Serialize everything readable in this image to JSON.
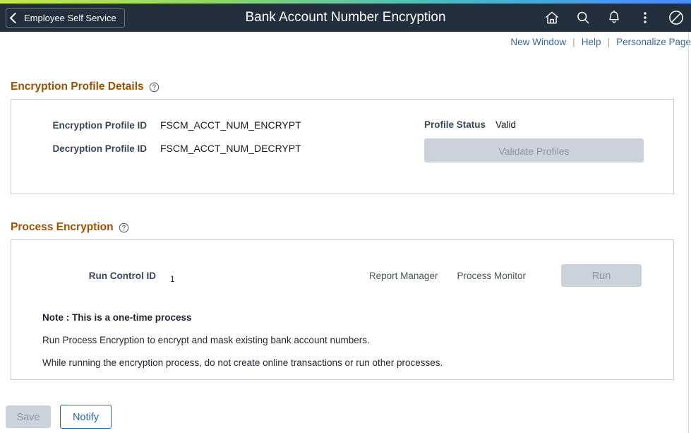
{
  "header": {
    "back_label": "Employee Self Service",
    "back_icon": "chevron-left-icon",
    "title": "Bank Account Number Encryption",
    "icons": [
      {
        "name": "home-icon",
        "label": "Home"
      },
      {
        "name": "search-icon",
        "label": "Search"
      },
      {
        "name": "notification-bell-icon",
        "label": "Notifications"
      },
      {
        "name": "actions-menu-icon",
        "label": "Actions"
      },
      {
        "name": "navigator-compass-icon",
        "label": "NavBar"
      }
    ],
    "accent_bar_colors": [
      "#c6e84a",
      "#7fd07f",
      "#4fa8d8",
      "#4d8bf0"
    ],
    "background_color": "#232f3d"
  },
  "utility_links": {
    "new_window": "New Window",
    "help": "Help",
    "personalize_page": "Personalize Page",
    "separator": "|",
    "link_color": "#37699e"
  },
  "encryption_profile_details": {
    "section_title": "Encryption Profile Details",
    "help_icon": "help-circle-icon",
    "fields": [
      {
        "label": "Encryption Profile ID",
        "value": "FSCM_ACCT_NUM_ENCRYPT"
      },
      {
        "label": "Decryption Profile ID",
        "value": "FSCM_ACCT_NUM_DECRYPT"
      }
    ],
    "profile_status_label": "Profile Status",
    "profile_status_value": "Valid",
    "validate_button": "Validate Profiles",
    "validate_button_enabled": false
  },
  "process_encryption": {
    "section_title": "Process Encryption",
    "help_icon": "help-circle-icon",
    "run_control_label": "Run Control ID",
    "run_control_value": "1",
    "report_manager": "Report Manager",
    "process_monitor": "Process Monitor",
    "run_button": "Run",
    "run_button_enabled": false,
    "note_title": "Note : This is a one-time process",
    "note_lines": [
      "Run Process Encryption to encrypt and mask existing bank account numbers.",
      "While running the encryption process, do not create online transactions or run other processes."
    ]
  },
  "footer": {
    "save_label": "Save",
    "save_enabled": false,
    "notify_label": "Notify",
    "notify_enabled": true
  },
  "colors": {
    "section_heading": "#a05000",
    "panel_border": "#c3ced8",
    "disabled_button_bg": "#ccd2dc",
    "disabled_button_text": "#8e94a0",
    "notify_border": "#2a68b0"
  }
}
